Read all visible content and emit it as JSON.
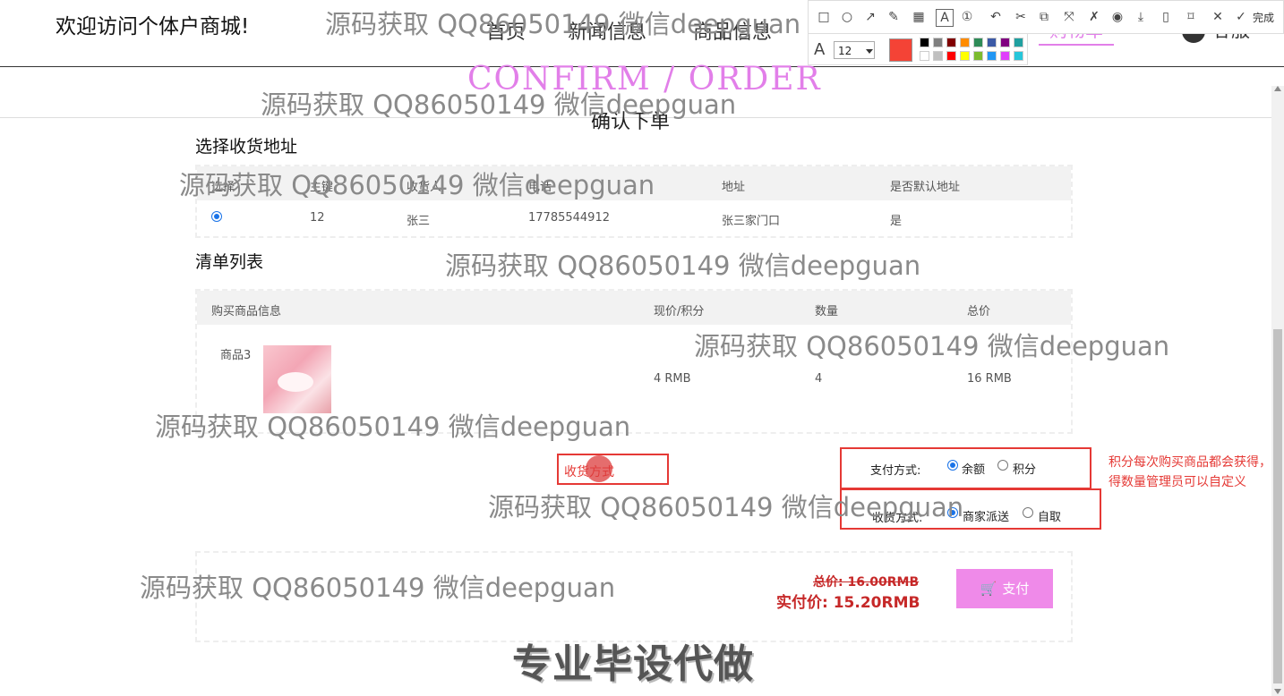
{
  "header": {
    "site_title": "欢迎访问个体户商城!",
    "nav": [
      "首页",
      "新闻信息",
      "商品信息"
    ],
    "cart": "购物车",
    "service": "客服"
  },
  "page": {
    "heading_en": "CONFIRM / ORDER",
    "heading_cn": "确认下单"
  },
  "address": {
    "title": "选择收货地址",
    "columns": [
      "选择",
      "主键",
      "收货人",
      "电话",
      "地址",
      "是否默认地址"
    ],
    "rows": [
      {
        "selected": true,
        "id": "12",
        "name": "张三",
        "phone": "17785544912",
        "address": "张三家门口",
        "default": "是"
      }
    ]
  },
  "items": {
    "title": "清单列表",
    "columns": [
      "购买商品信息",
      "现价/积分",
      "数量",
      "总价"
    ],
    "rows": [
      {
        "name": "商品3",
        "price": "4 RMB",
        "qty": "4",
        "total": "16 RMB"
      }
    ]
  },
  "payment": {
    "label": "支付方式:",
    "options": [
      {
        "label": "余额",
        "selected": true
      },
      {
        "label": "积分",
        "selected": false
      }
    ]
  },
  "delivery": {
    "label": "收货方式:",
    "options": [
      {
        "label": "商家派送",
        "selected": true
      },
      {
        "label": "自取",
        "selected": false
      }
    ]
  },
  "annotations": {
    "box_text": "收货方式",
    "note": "积分每次购买商品都会获得，获得数量管理员可以自定义"
  },
  "totals": {
    "original": "总价: 16.00RMB",
    "actual": "实付价: 15.20RMB",
    "pay_button": "支付"
  },
  "watermark": {
    "text": "源码获取 QQ86050149 微信deepguan",
    "big_text": "专业毕设代做"
  },
  "toolbar": {
    "done": "完成",
    "font_size": "12",
    "current_color": "#f44336",
    "swatches": [
      "#000000",
      "#808080",
      "#800000",
      "#ff8c00",
      "#2e8b57",
      "#3c5aa6",
      "#800080",
      "#20a0a0",
      "#ffffff",
      "#c0c0c0",
      "#ff0000",
      "#ffff00",
      "#7cbb2e",
      "#2196f3",
      "#e040fb",
      "#26c6da"
    ],
    "icons": [
      "rectangle-icon",
      "circle-icon",
      "arrow-icon",
      "pen-icon",
      "mosaic-icon",
      "text-icon",
      "number-icon",
      "undo-icon",
      "cut-icon",
      "copy-icon",
      "crop-icon",
      "pin-icon",
      "record-icon",
      "download-icon",
      "phone-icon",
      "bookmark-icon",
      "close-icon",
      "check-icon"
    ]
  },
  "colors": {
    "accent": "#e27fe9",
    "button": "#ef8ae9",
    "annotation": "#e53935",
    "price": "#c62828"
  }
}
